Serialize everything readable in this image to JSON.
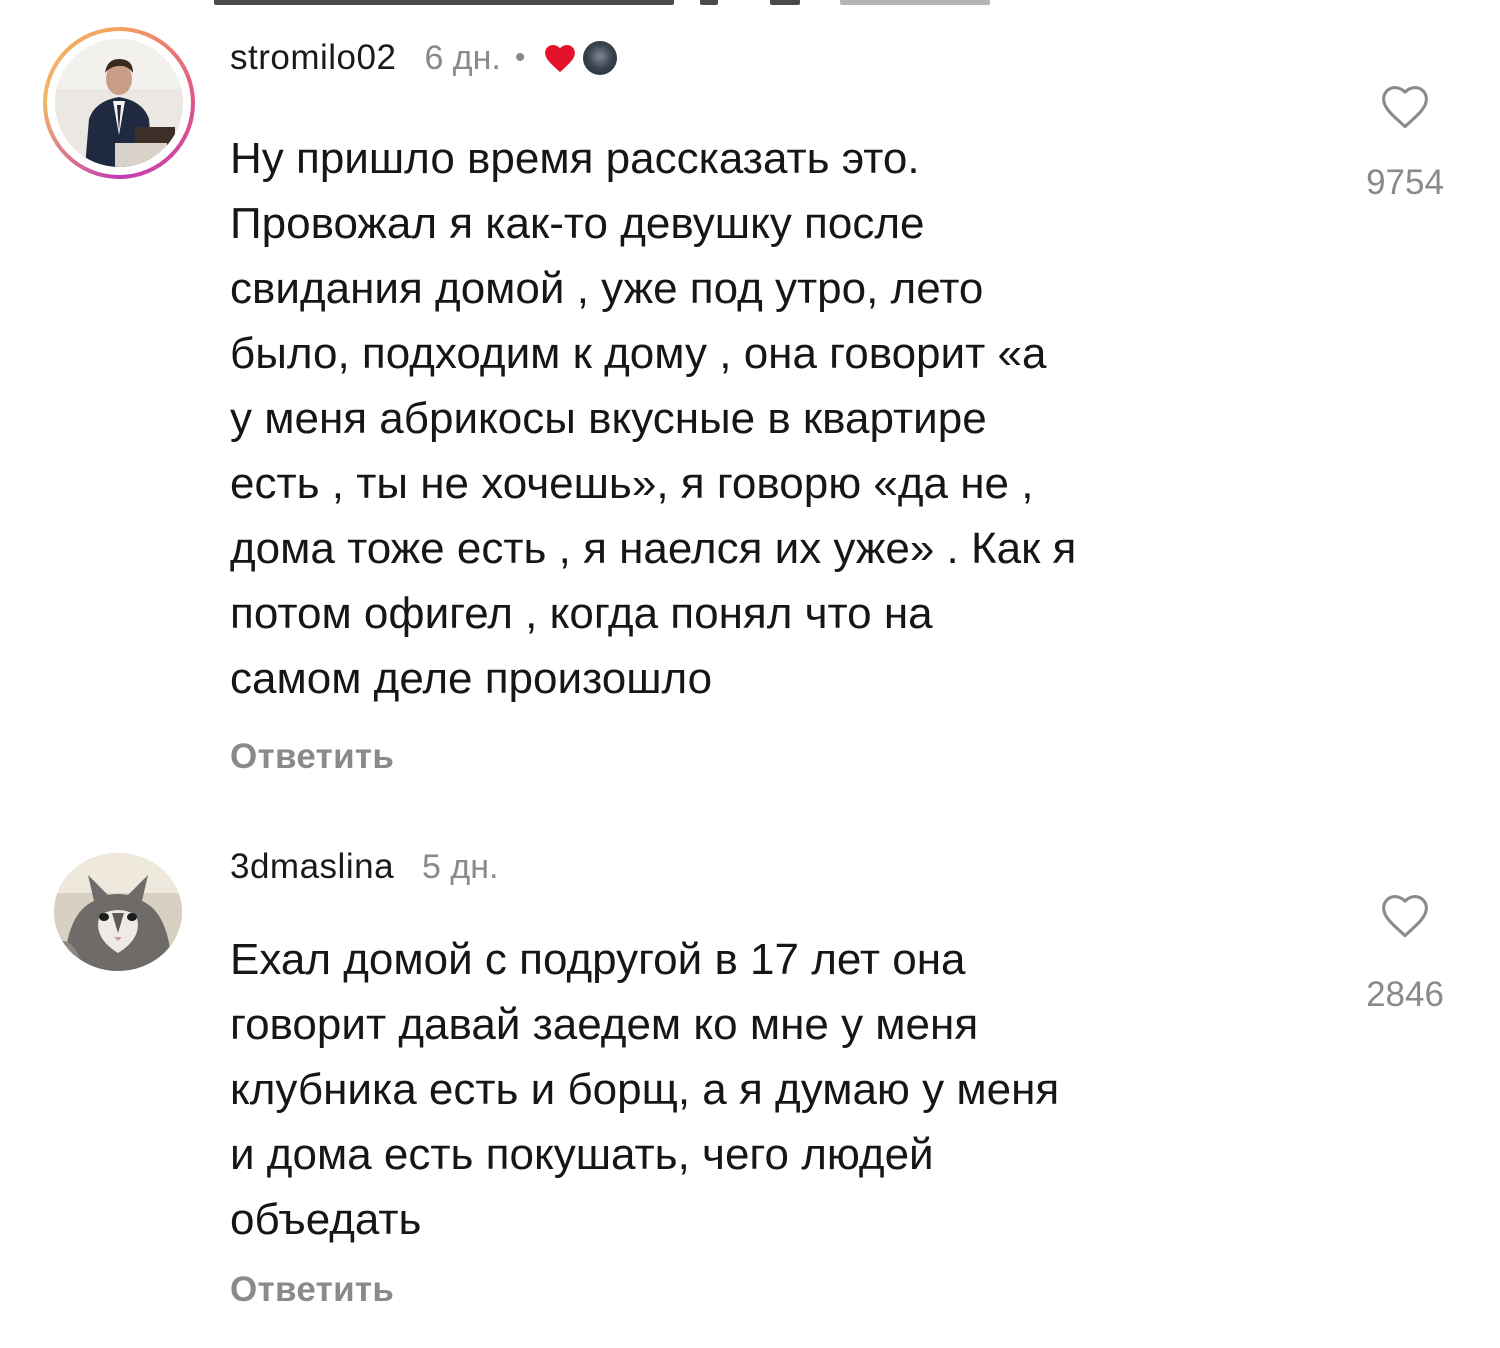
{
  "colors": {
    "text": "#161616",
    "secondary": "#8a8a8a",
    "heart_red": "#e4122a",
    "story_ring": "#e0538c"
  },
  "comments": [
    {
      "username": "stromilo02",
      "time": "6 дн.",
      "separator": "•",
      "badges": [
        "heart-icon",
        "author-avatar"
      ],
      "avatar": "person-in-suit-avatar",
      "story_ring": true,
      "text_lines": [
        "Ну пришло время рассказать это.",
        "Провожал я как-то девушку после",
        "свидания домой , уже под утро, лето",
        "было, подходим к дому , она говорит «а",
        "у меня абрикосы вкусные в квартире",
        "есть , ты не хочешь», я говорю «да не ,",
        "дома тоже есть , я наелся их уже» . Как я",
        "потом офигел , когда понял что на",
        "самом деле произошло"
      ],
      "reply_label": "Ответить",
      "likes": "9754",
      "like_icon": "heart-outline-icon"
    },
    {
      "username": "3dmaslina",
      "time": "5 дн.",
      "avatar": "cat-avatar",
      "story_ring": false,
      "text_lines": [
        "Ехал домой с подругой в 17 лет она",
        "говорит давай заедем ко мне у меня",
        "клубника есть и борщ, а я думаю у меня",
        "и дома есть покушать, чего людей",
        "объедать"
      ],
      "reply_label": "Ответить",
      "likes": "2846",
      "like_icon": "heart-outline-icon"
    }
  ]
}
